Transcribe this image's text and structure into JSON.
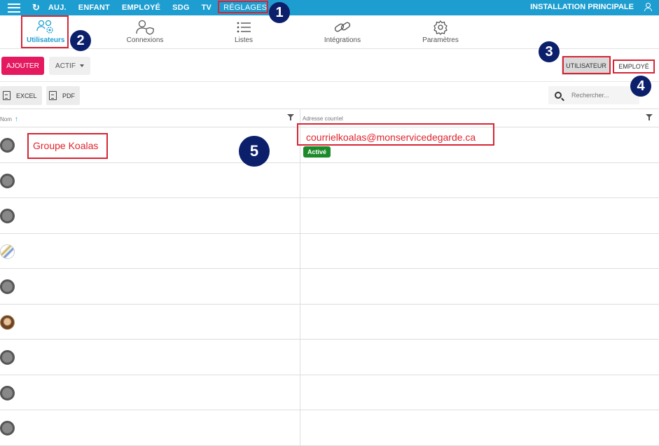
{
  "topbar": {
    "nav": [
      "AUJ.",
      "ENFANT",
      "EMPLOYÉ",
      "SDG",
      "TV",
      "RÉGLAGES"
    ],
    "right_label": "INSTALLATION PRINCIPALE",
    "refresh_glyph": "↻"
  },
  "tabs": [
    {
      "label": "Utilisateurs",
      "icon": "users-gear-icon",
      "active": true
    },
    {
      "label": "Connexions",
      "icon": "user-shield-icon",
      "active": false
    },
    {
      "label": "Listes",
      "icon": "list-icon",
      "active": false
    },
    {
      "label": "Intégrations",
      "icon": "link-icon",
      "active": false
    },
    {
      "label": "Paramètres",
      "icon": "gear-icon",
      "active": false
    }
  ],
  "toolbar": {
    "add_label": "AJOUTER",
    "filter_label": "ACTIF",
    "toggle_user": "UTILISATEUR",
    "toggle_employee": "EMPLOYÉ",
    "excel_label": "EXCEL",
    "pdf_label": "PDF",
    "search_placeholder": "Rechercher..."
  },
  "table": {
    "col_name": "Nom",
    "col_email": "Adresse courriel",
    "first_row": {
      "name": "Groupe Koalas",
      "email": "courrielkoalas@monservicedegarde.ca",
      "status": "Activé"
    }
  },
  "annotations": [
    "1",
    "2",
    "3",
    "4",
    "5"
  ],
  "colors": {
    "brand": "#1e9ed0",
    "add_button": "#e5195f",
    "highlight": "#d62535",
    "badge": "#0b1f6b",
    "status_active": "#1d8a2a"
  }
}
